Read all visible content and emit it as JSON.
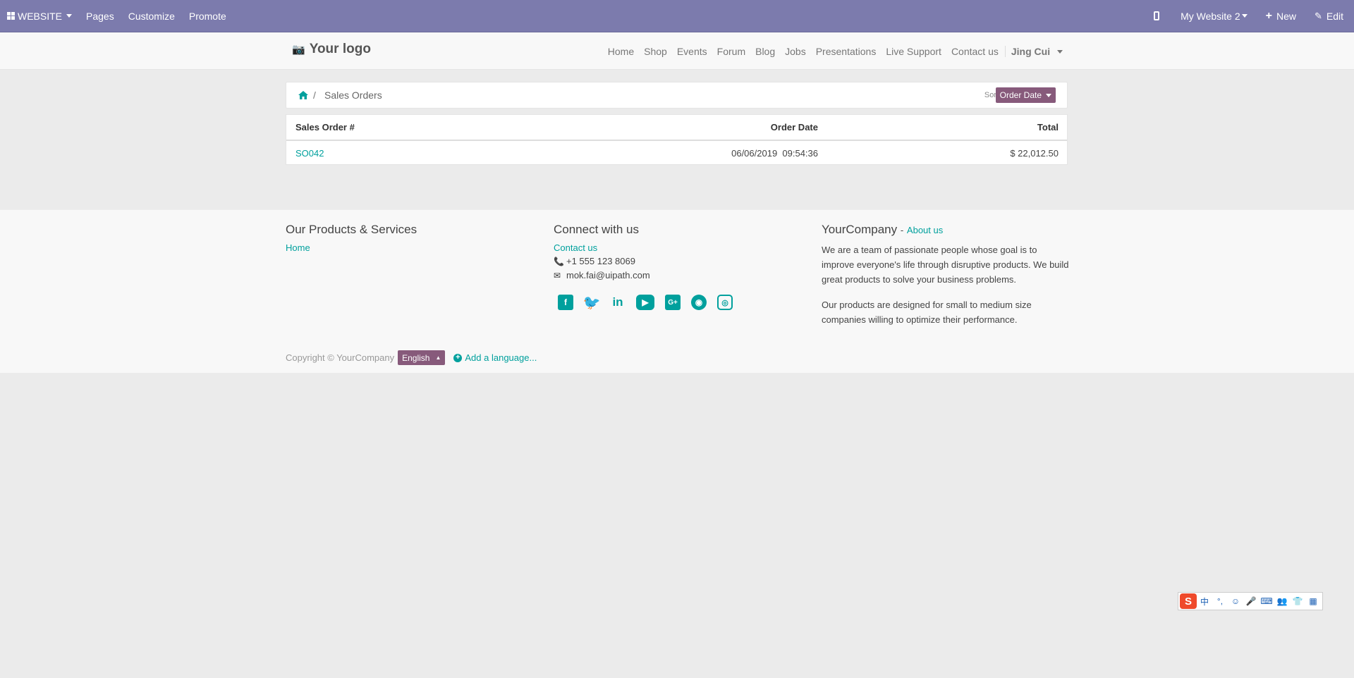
{
  "adminbar": {
    "website_label": "WEBSITE",
    "items": [
      "Pages",
      "Customize",
      "Promote"
    ],
    "website_selector": "My Website 2",
    "new_label": "New",
    "edit_label": "Edit"
  },
  "header": {
    "logo_text": "Your logo",
    "nav": [
      "Home",
      "Shop",
      "Events",
      "Forum",
      "Blog",
      "Jobs",
      "Presentations",
      "Live Support",
      "Contact us"
    ],
    "user": "Jing Cui"
  },
  "breadcrumb": {
    "separator": "/",
    "current": "Sales Orders",
    "sort_label": "Sort By:",
    "sort_value": "Order Date"
  },
  "orders": {
    "columns": [
      "Sales Order #",
      "Order Date",
      "Total"
    ],
    "rows": [
      {
        "number": "SO042",
        "date": "06/06/2019  09:54:36",
        "total": "$ 22,012.50"
      }
    ]
  },
  "footer": {
    "col1_title": "Our Products & Services",
    "col1_link": "Home",
    "col2_title": "Connect with us",
    "contact_link": "Contact us",
    "phone": "+1 555 123 8069",
    "email": "mok.fai@uipath.com",
    "social_icons": [
      "facebook-icon",
      "twitter-icon",
      "linkedin-icon",
      "youtube-icon",
      "google-plus-icon",
      "github-icon",
      "instagram-icon"
    ],
    "col3_title": "YourCompany",
    "col3_dash": "-",
    "about_link": "About us",
    "para1": "We are a team of passionate people whose goal is to improve everyone's life through disruptive products. We build great products to solve your business problems.",
    "para2": "Our products are designed for small to medium size companies willing to optimize their performance.",
    "copyright": "Copyright © YourCompany",
    "language": "English",
    "add_language": "Add a language..."
  },
  "colors": {
    "adminbar": "#7c7bad",
    "accent": "#00a09d",
    "button": "#875a7b"
  },
  "ime": {
    "logo": "S",
    "items": [
      "中",
      "°,",
      "☺",
      "🎤",
      "⌨",
      "👥",
      "👕",
      "▦"
    ]
  }
}
